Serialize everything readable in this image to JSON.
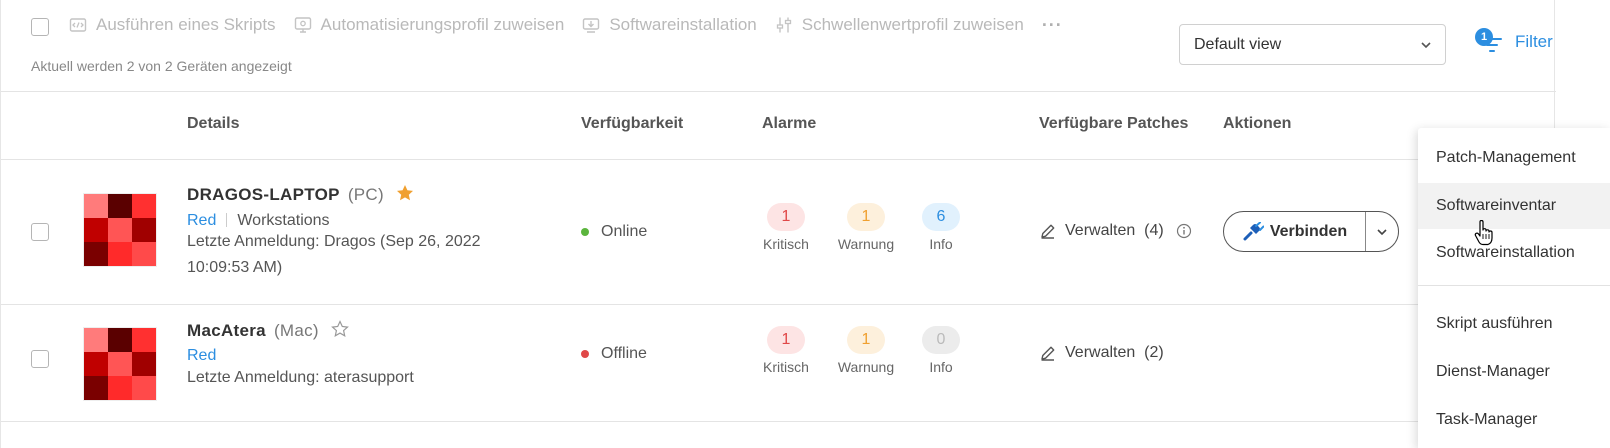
{
  "toolbar": {
    "actions": [
      {
        "label": "Ausführen eines Skripts",
        "icon": "script-icon"
      },
      {
        "label": "Automatisierungsprofil zuweisen",
        "icon": "automation-profile-icon"
      },
      {
        "label": "Softwareinstallation",
        "icon": "software-install-icon"
      },
      {
        "label": "Schwellenwertprofil zuweisen",
        "icon": "threshold-sliders-icon"
      }
    ],
    "more": "···",
    "count_text": "Aktuell werden 2 von 2 Geräten angezeigt",
    "view_select": "Default view",
    "filter_label": "Filter",
    "filter_count": "1"
  },
  "columns": {
    "details": "Details",
    "availability": "Verfügbarkeit",
    "alarms": "Alarme",
    "patches": "Verfügbare Patches",
    "actions": "Aktionen"
  },
  "devices": [
    {
      "name": "DRAGOS-LAPTOP",
      "type": "(PC)",
      "favorite": true,
      "customer": "Red",
      "folder": "Workstations",
      "login_line1": "Letzte Anmeldung: Dragos (Sep 26, 2022",
      "login_line2": "10:09:53 AM)",
      "status": "Online",
      "status_color": "#5bb53d",
      "alarms": {
        "critical": "1",
        "warning": "1",
        "info": "6"
      },
      "alarm_labels": {
        "critical": "Kritisch",
        "warning": "Warnung",
        "info": "Info"
      },
      "patches": "Verwalten  (4)",
      "connect_label": "Verbinden"
    },
    {
      "name": "MacAtera",
      "type": "(Mac)",
      "favorite": false,
      "customer": "Red",
      "login_line1": "Letzte Anmeldung: aterasupport",
      "status": "Offline",
      "status_color": "#e04848",
      "alarms": {
        "critical": "1",
        "warning": "1",
        "info": "0"
      },
      "alarm_labels": {
        "critical": "Kritisch",
        "warning": "Warnung",
        "info": "Info"
      },
      "patches": "Verwalten  (2)"
    }
  ],
  "menu": {
    "items": [
      "Patch-Management",
      "Softwareinventar",
      "Softwareinstallation",
      "Skript ausführen",
      "Dienst-Manager",
      "Task-Manager"
    ],
    "hovered": "Softwareinventar"
  },
  "colors": {
    "accent": "#2c8ee0",
    "critical_bg": "#fde4e4",
    "critical_fg": "#e04848",
    "warning_bg": "#fdf0dc",
    "warning_fg": "#f0a030",
    "info_bg": "#e1f1fd",
    "info_fg": "#2c8ee0",
    "zero_bg": "#ececec",
    "zero_fg": "#bbbbbb",
    "star": "#f0a030"
  }
}
